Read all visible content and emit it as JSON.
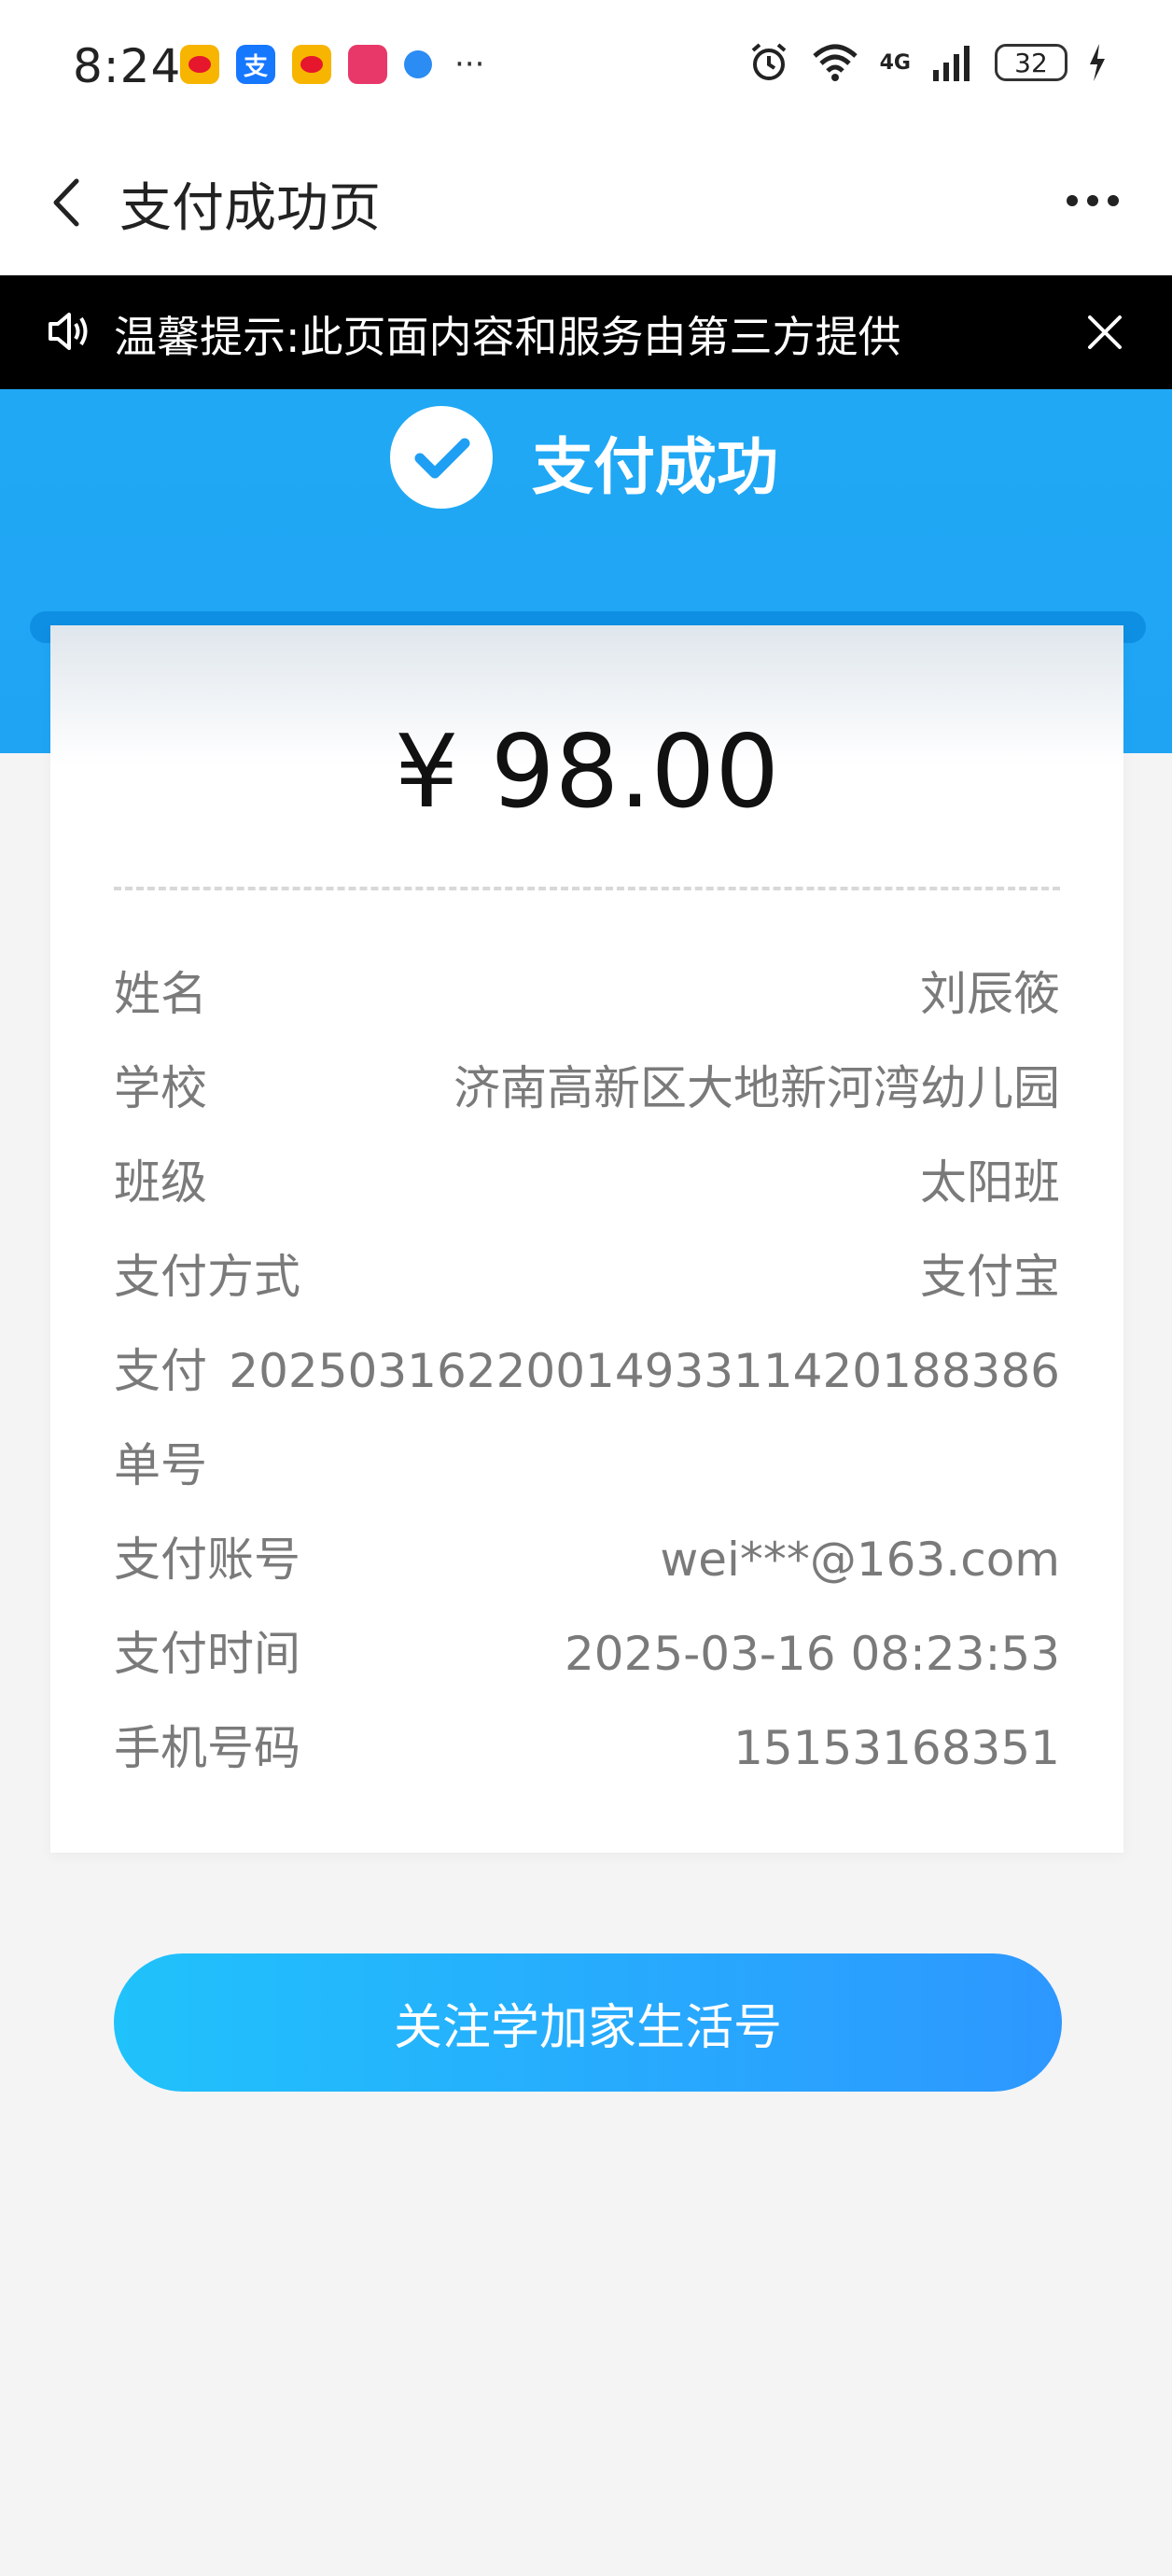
{
  "status_bar": {
    "time": "8:24",
    "battery": "32",
    "network": "4G",
    "more": "···"
  },
  "nav": {
    "title": "支付成功页"
  },
  "notice": {
    "text": "温馨提示:此页面内容和服务由第三方提供"
  },
  "hero": {
    "title": "支付成功"
  },
  "receipt": {
    "amount": "¥ 98.00",
    "rows": [
      {
        "label": "姓名",
        "value": "刘辰筱"
      },
      {
        "label": "学校",
        "value": "济南高新区大地新河湾幼儿园"
      },
      {
        "label": "班级",
        "value": "太阳班"
      },
      {
        "label": "支付方式",
        "value": "支付宝"
      },
      {
        "label": "支付单号",
        "value": "2025031622001493311420188386"
      },
      {
        "label": "支付账号",
        "value": "wei***@163.com"
      },
      {
        "label": "支付时间",
        "value": "2025-03-16 08:23:53"
      },
      {
        "label": "手机号码",
        "value": "15153168351"
      }
    ]
  },
  "cta": {
    "label": "关注学加家生活号"
  },
  "colors": {
    "primary_blue": "#1e9ff3",
    "cta_start": "#20c2fb",
    "cta_end": "#2d97ff",
    "notice_bg": "#000000"
  },
  "icons": {
    "status_apps": [
      "weibo-icon",
      "alipay-icon",
      "weibo-icon",
      "pink-app-icon",
      "blue-dot-icon"
    ],
    "status_right": [
      "alarm-icon",
      "wifi-icon",
      "signal-icon",
      "battery-icon",
      "charging-icon"
    ]
  }
}
